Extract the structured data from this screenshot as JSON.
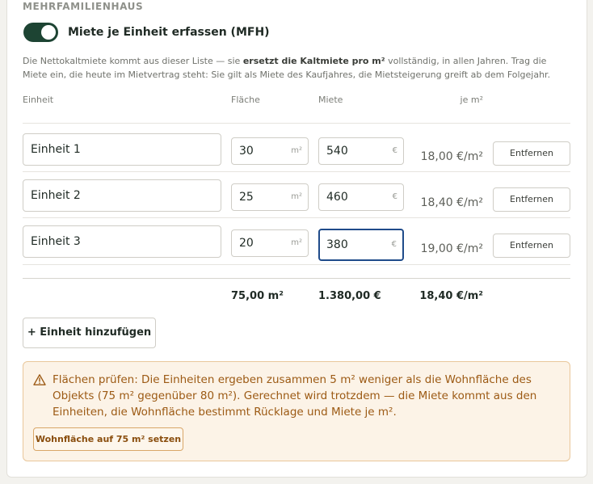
{
  "section": {
    "title": "MEHRFAMILIENHAUS"
  },
  "toggle": {
    "label": "Miete je Einheit erfassen (MFH)",
    "on": true
  },
  "description": {
    "part1": "Die Nettokaltmiete kommt aus dieser Liste — sie ",
    "bold": "ersetzt die Kaltmiete pro m²",
    "part2": " vollständig, in allen Jahren. Trag die Miete ein, die heute im Mietvertrag steht: Sie gilt als Miete des Kaufjahres, die Mietsteigerung greift ab dem Folgejahr."
  },
  "columns": {
    "unit": "Einheit",
    "area": "Fläche",
    "rent": "Miete",
    "per_m2": "je m²"
  },
  "units": [
    {
      "name": "Einheit 1",
      "area": "30",
      "area_unit": "m²",
      "rent": "540",
      "rent_unit": "€",
      "per_m2": "18,00 €/m²",
      "remove": "Entfernen"
    },
    {
      "name": "Einheit 2",
      "area": "25",
      "area_unit": "m²",
      "rent": "460",
      "rent_unit": "€",
      "per_m2": "18,40 €/m²",
      "remove": "Entfernen"
    },
    {
      "name": "Einheit 3",
      "area": "20",
      "area_unit": "m²",
      "rent": "380",
      "rent_unit": "€",
      "per_m2": "19,00 €/m²",
      "remove": "Entfernen"
    }
  ],
  "totals": {
    "area": "75,00 m²",
    "rent": "1.380,00 €",
    "per_m2": "18,40 €/m²"
  },
  "add_button": "+ Einheit hinzufügen",
  "warning": {
    "icon": "warning-triangle-icon",
    "text": "Flächen prüfen: Die Einheiten ergeben zusammen 5 m² weniger als die Wohnfläche des Objekts (75 m² gegenüber 80 m²). Gerechnet wird trotzdem — die Miete kommt aus den Einheiten, die Wohnfläche bestimmt Rücklage und Miete je m².",
    "button": "Wohnfläche auf 75 m² setzen"
  },
  "colors": {
    "accent": "#1d4433",
    "focus": "#1f4b8a",
    "warning_bg": "#fcf3e7",
    "warning_text": "#9c5a14"
  }
}
